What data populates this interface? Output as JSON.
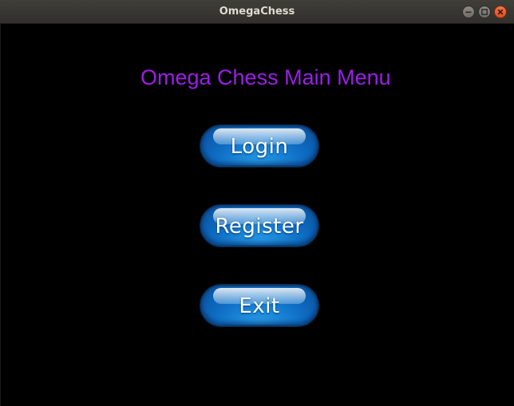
{
  "window": {
    "title": "OmegaChess"
  },
  "main_menu": {
    "heading": "Omega Chess Main Menu",
    "buttons": {
      "login": "Login",
      "register": "Register",
      "exit": "Exit"
    }
  },
  "colors": {
    "background": "#000000",
    "heading": "#9b1ee8",
    "button_blue": "#0f6fc6",
    "close_button": "#e2612e"
  },
  "icons": {
    "minimize": "minimize-icon",
    "maximize": "maximize-icon",
    "close": "close-icon"
  }
}
